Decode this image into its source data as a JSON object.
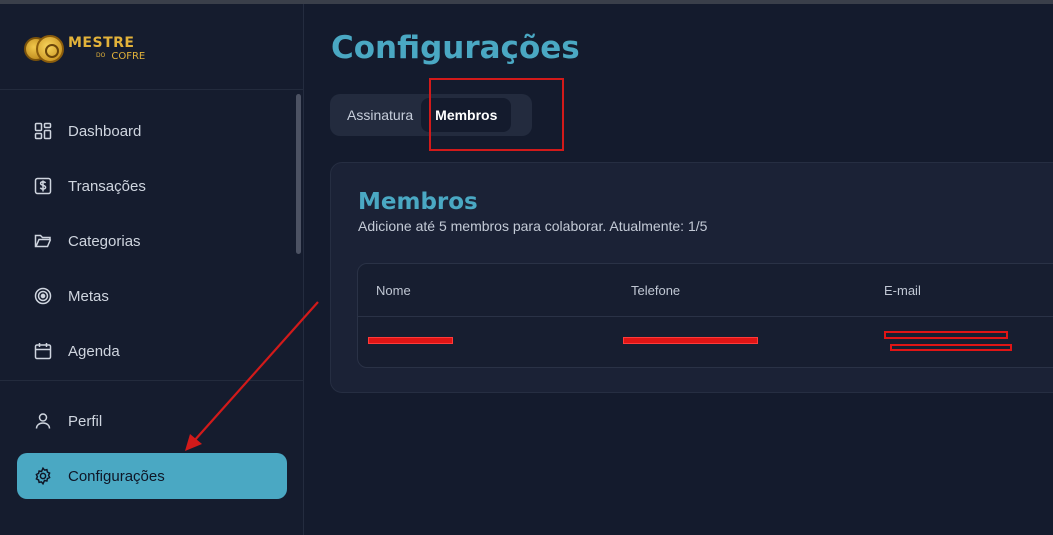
{
  "app": {
    "logo_line1": "MESTRE",
    "logo_small": "DO",
    "logo_line2": "COFRE"
  },
  "sidebar": {
    "items": [
      {
        "label": "Dashboard",
        "icon": "dashboard-icon"
      },
      {
        "label": "Transações",
        "icon": "dollar-receipt-icon"
      },
      {
        "label": "Categorias",
        "icon": "folder-icon"
      },
      {
        "label": "Metas",
        "icon": "target-icon"
      },
      {
        "label": "Agenda",
        "icon": "calendar-icon"
      }
    ],
    "bottom_items": [
      {
        "label": "Perfil",
        "icon": "user-icon"
      },
      {
        "label": "Configurações",
        "icon": "gear-icon",
        "active": true
      }
    ]
  },
  "main": {
    "title": "Configurações",
    "tabs": [
      {
        "label": "Assinatura"
      },
      {
        "label": "Membros",
        "active": true
      }
    ],
    "members_card": {
      "title": "Membros",
      "subtitle": "Adicione até 5 membros para colaborar. Atualmente: 1/5",
      "columns": [
        "Nome",
        "Telefone",
        "E-mail"
      ]
    }
  },
  "colors": {
    "accent": "#4aa8c3",
    "background": "#141b2d",
    "annotation_red": "#d21a1a"
  }
}
